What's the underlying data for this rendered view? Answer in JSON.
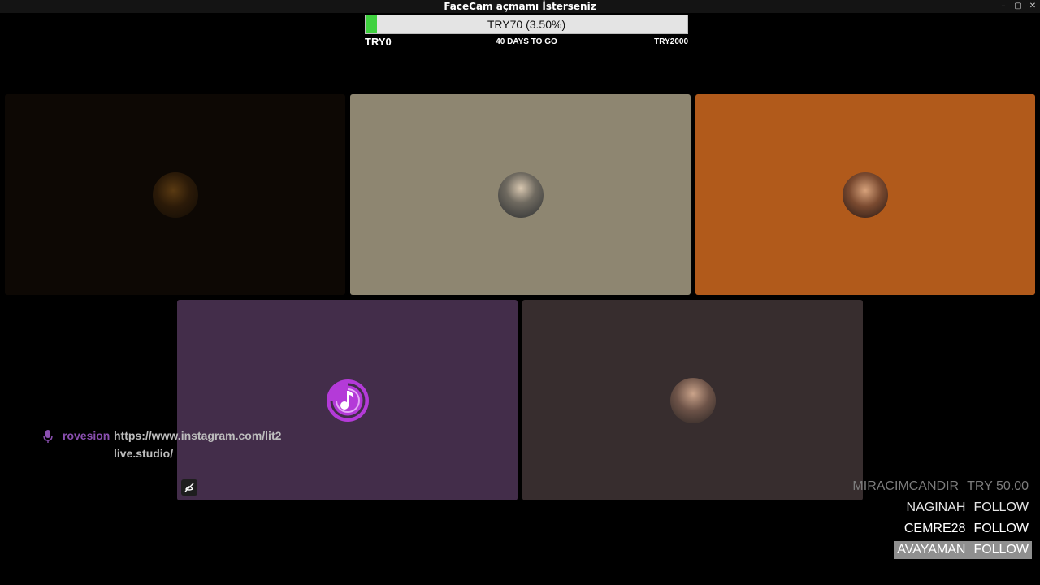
{
  "window": {
    "title": "FaceCam açmamı İsterseniz",
    "controls": [
      "–",
      "▢",
      "✕"
    ]
  },
  "goal": {
    "progress_text": "TRY70 (3.50%)",
    "progress_fraction": 0.035,
    "start_label": "TRY0",
    "days_label": "40 DAYS TO GO",
    "end_label": "TRY2000",
    "fill_color": "#3fd13f"
  },
  "participants": [
    {
      "tile_color": "#0d0804",
      "avatar": "avatar-photo"
    },
    {
      "tile_color": "#8e8671",
      "avatar": "avatar-photo"
    },
    {
      "tile_color": "#b15a1b",
      "avatar": "avatar-photo"
    },
    {
      "tile_color": "#432d4a",
      "avatar": "music-note-icon",
      "muted": true
    },
    {
      "tile_color": "#372d2e",
      "avatar": "avatar-photo"
    }
  ],
  "caption": {
    "icon": "microphone-icon",
    "user": "rovesion",
    "message": "https://www.instagram.com/lit2live.studio/"
  },
  "events": [
    {
      "name": "MIRACIMCANDIR",
      "action": "TRY 50.00",
      "style": "dim"
    },
    {
      "name": "NAGINAH",
      "action": "FOLLOW",
      "style": "light"
    },
    {
      "name": "CEMRE28",
      "action": "FOLLOW",
      "style": "white"
    },
    {
      "name": "AVAYAMAN",
      "action": "FOLLOW",
      "style": "highlight"
    }
  ]
}
